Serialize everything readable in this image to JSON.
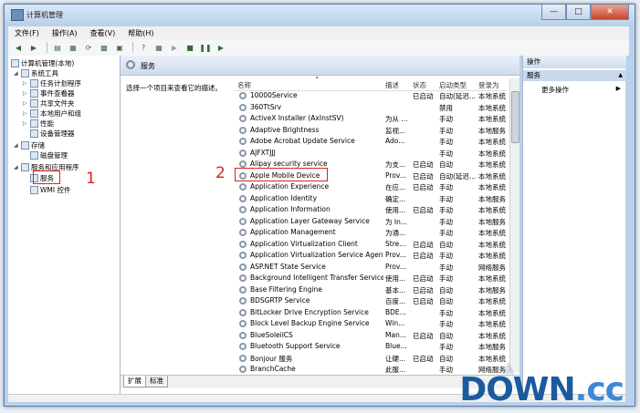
{
  "window": {
    "title": "计算机管理"
  },
  "menu": [
    "文件(F)",
    "操作(A)",
    "查看(V)",
    "帮助(H)"
  ],
  "tree": {
    "root": "计算机管理(本地)",
    "items": [
      {
        "label": "系统工具",
        "level": 1
      },
      {
        "label": "任务计划程序",
        "level": 2
      },
      {
        "label": "事件查看器",
        "level": 2
      },
      {
        "label": "共享文件夹",
        "level": 2
      },
      {
        "label": "本地用户和组",
        "level": 2
      },
      {
        "label": "性能",
        "level": 2
      },
      {
        "label": "设备管理器",
        "level": 2
      },
      {
        "label": "存储",
        "level": 1
      },
      {
        "label": "磁盘管理",
        "level": 2
      },
      {
        "label": "服务和应用程序",
        "level": 1
      },
      {
        "label": "服务",
        "level": 2
      },
      {
        "label": "WMI 控件",
        "level": 2
      }
    ]
  },
  "annotations": {
    "one": "1",
    "two": "2"
  },
  "center": {
    "title": "服务",
    "description": "选择一个项目来查看它的描述。",
    "columns": {
      "name": "名称",
      "desc": "描述",
      "status": "状态",
      "startup": "启动类型",
      "logon": "登录为"
    },
    "services": [
      {
        "name": "10000Service",
        "desc": "",
        "status": "已启动",
        "startup": "自动(延迟...",
        "logon": "本地系统"
      },
      {
        "name": "360TtSrv",
        "desc": "",
        "status": "",
        "startup": "禁用",
        "logon": "本地系统"
      },
      {
        "name": "ActiveX Installer (AxInstSV)",
        "desc": "为从 ...",
        "status": "",
        "startup": "手动",
        "logon": "本地系统"
      },
      {
        "name": "Adaptive Brightness",
        "desc": "监视...",
        "status": "",
        "startup": "手动",
        "logon": "本地服务"
      },
      {
        "name": "Adobe Acrobat Update Service",
        "desc": "Ado...",
        "status": "",
        "startup": "手动",
        "logon": "本地系统"
      },
      {
        "name": "AJFXTJJJ",
        "desc": "",
        "status": "",
        "startup": "手动",
        "logon": "本地系统"
      },
      {
        "name": "Alipay security service",
        "desc": "为支...",
        "status": "已启动",
        "startup": "自动",
        "logon": "本地系统"
      },
      {
        "name": "Apple Mobile Device",
        "desc": "Prov...",
        "status": "已启动",
        "startup": "自动(延迟...",
        "logon": "本地系统"
      },
      {
        "name": "Application Experience",
        "desc": "在应...",
        "status": "已启动",
        "startup": "手动",
        "logon": "本地系统"
      },
      {
        "name": "Application Identity",
        "desc": "确定...",
        "status": "",
        "startup": "手动",
        "logon": "本地服务"
      },
      {
        "name": "Application Information",
        "desc": "使用...",
        "status": "已启动",
        "startup": "手动",
        "logon": "本地系统"
      },
      {
        "name": "Application Layer Gateway Service",
        "desc": "为 In...",
        "status": "",
        "startup": "手动",
        "logon": "本地服务"
      },
      {
        "name": "Application Management",
        "desc": "为通...",
        "status": "",
        "startup": "手动",
        "logon": "本地系统"
      },
      {
        "name": "Application Virtualization Client",
        "desc": "Stre...",
        "status": "已启动",
        "startup": "自动",
        "logon": "本地系统"
      },
      {
        "name": "Application Virtualization Service Agent",
        "desc": "Prov...",
        "status": "已启动",
        "startup": "手动",
        "logon": "本地系统"
      },
      {
        "name": "ASP.NET State Service",
        "desc": "Prov...",
        "status": "",
        "startup": "手动",
        "logon": "网络服务"
      },
      {
        "name": "Background Intelligent Transfer Service",
        "desc": "使用...",
        "status": "已启动",
        "startup": "手动",
        "logon": "本地系统"
      },
      {
        "name": "Base Filtering Engine",
        "desc": "基本...",
        "status": "已启动",
        "startup": "自动",
        "logon": "本地服务"
      },
      {
        "name": "BDSGRTP Service",
        "desc": "百度...",
        "status": "已启动",
        "startup": "自动",
        "logon": "本地系统"
      },
      {
        "name": "BitLocker Drive Encryption Service",
        "desc": "BDE...",
        "status": "",
        "startup": "手动",
        "logon": "本地系统"
      },
      {
        "name": "Block Level Backup Engine Service",
        "desc": "Win...",
        "status": "",
        "startup": "手动",
        "logon": "本地系统"
      },
      {
        "name": "BlueSoleilCS",
        "desc": "Man...",
        "status": "已启动",
        "startup": "自动",
        "logon": "本地系统"
      },
      {
        "name": "Bluetooth Support Service",
        "desc": "Blue...",
        "status": "",
        "startup": "手动",
        "logon": "本地服务"
      },
      {
        "name": "Bonjour 服务",
        "desc": "让硬...",
        "status": "已启动",
        "startup": "自动",
        "logon": "本地系统"
      },
      {
        "name": "BranchCache",
        "desc": "此服...",
        "status": "",
        "startup": "手动",
        "logon": "网络服务"
      }
    ],
    "tabs": [
      "扩展",
      "标准"
    ]
  },
  "actions": {
    "title": "操作",
    "subtitle": "服务",
    "more": "更多操作"
  },
  "watermark": {
    "text": "DOWN",
    "suffix": ".cc"
  }
}
